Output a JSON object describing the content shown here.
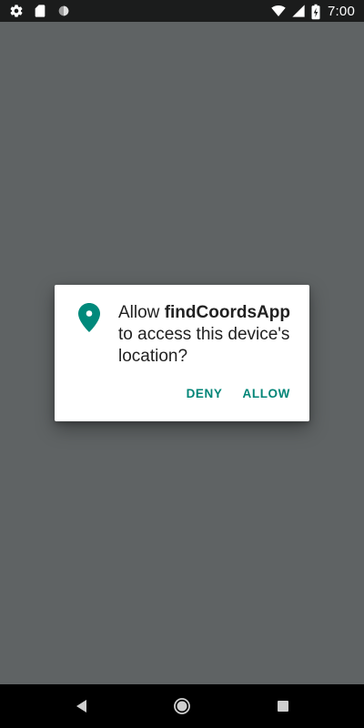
{
  "status_bar": {
    "time": "7:00",
    "left_icons": [
      "settings-icon",
      "sd-card-icon",
      "circle-icon"
    ],
    "right_icons": [
      "wifi-icon",
      "cell-signal-icon",
      "battery-charging-icon"
    ]
  },
  "dialog": {
    "icon": "location-pin-icon",
    "message_prefix": "Allow ",
    "app_name": "findCoordsApp",
    "message_suffix": " to access this device's location?",
    "deny_label": "DENY",
    "allow_label": "ALLOW"
  },
  "nav_bar": {
    "icons": [
      "back-icon",
      "home-icon",
      "recents-icon"
    ]
  },
  "colors": {
    "scrim": "#5f6364",
    "accent": "#008577",
    "status_bar": "#1b1c1c",
    "nav_bar": "#000000"
  }
}
